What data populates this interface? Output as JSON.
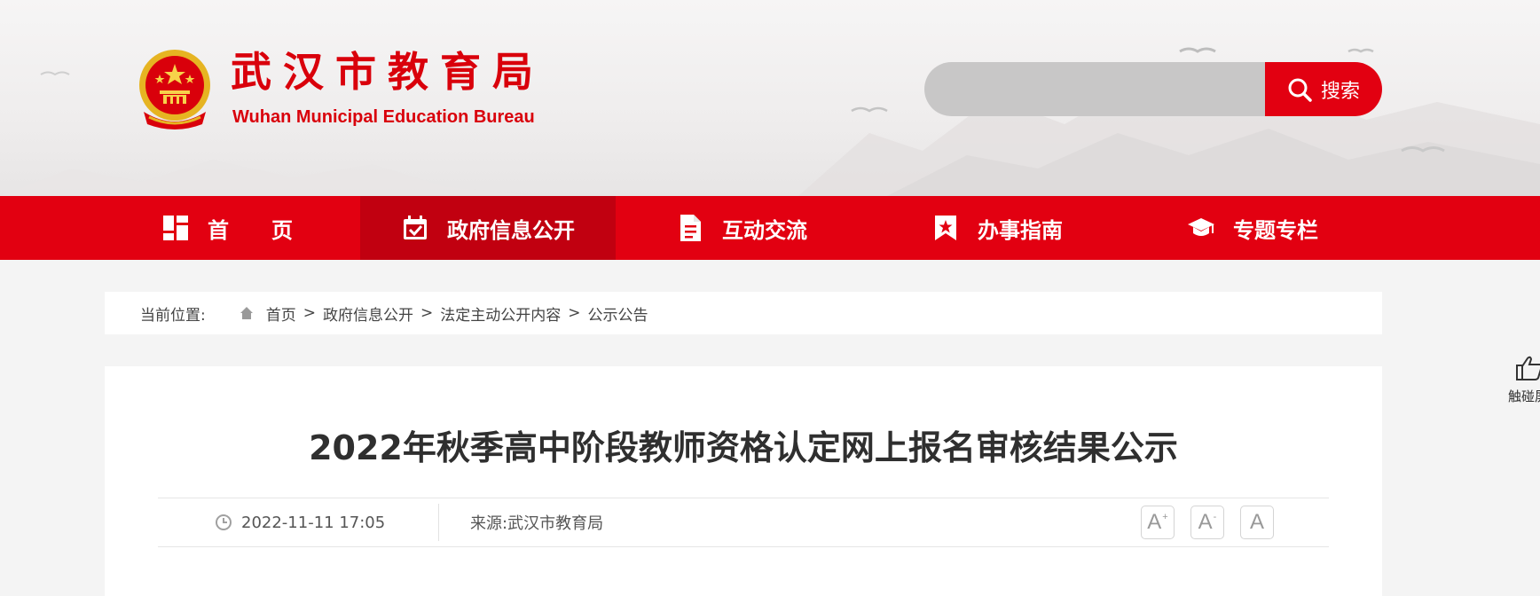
{
  "header": {
    "title": "武汉市教育局",
    "subtitle": "Wuhan Municipal Education Bureau",
    "search": {
      "placeholder": "",
      "button_label": "搜索"
    }
  },
  "nav": {
    "items": [
      {
        "label": "首页",
        "icon": "grid-layout-icon"
      },
      {
        "label": "政府信息公开",
        "icon": "calendar-check-icon",
        "active": true
      },
      {
        "label": "互动交流",
        "icon": "document-icon"
      },
      {
        "label": "办事指南",
        "icon": "bookmark-star-icon"
      },
      {
        "label": "专题专栏",
        "icon": "graduation-cap-icon"
      }
    ]
  },
  "breadcrumb": {
    "prefix": "当前位置:",
    "items": [
      "首页",
      "政府信息公开",
      "法定主动公开内容",
      "公示公告"
    ],
    "separator": ">"
  },
  "article": {
    "title": "2022年秋季高中阶段教师资格认定网上报名审核结果公示",
    "date": "2022-11-11 17:05",
    "source": "来源:武汉市教育局",
    "font_sizes": [
      {
        "label": "A",
        "sup": "+"
      },
      {
        "label": "A",
        "sup": "-"
      },
      {
        "label": "A",
        "sup": ""
      }
    ]
  },
  "touch_widget": {
    "label": "触碰屏"
  },
  "colors": {
    "brand_red": "#e20011",
    "nav_active": "#c10010",
    "title_red": "#d9000b"
  }
}
